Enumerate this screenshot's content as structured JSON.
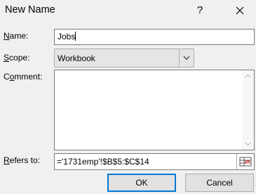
{
  "window": {
    "title": "New Name",
    "help_label": "?",
    "close_icon": "close-icon"
  },
  "fields": {
    "name_label_acc": "N",
    "name_label_rest": "ame:",
    "name_value": "Jobs",
    "scope_label_acc": "S",
    "scope_label_rest": "cope:",
    "scope_value": "Workbook",
    "comment_label_pre": "C",
    "comment_label_acc": "o",
    "comment_label_rest": "mment:",
    "comment_value": "",
    "refers_label_acc": "R",
    "refers_label_rest": "efers to:",
    "refers_value": "='1731emp'!$B$5:$C$14"
  },
  "buttons": {
    "ok_label": "OK",
    "cancel_label": "Cancel"
  },
  "colors": {
    "dialog_bg": "#f0f0f0",
    "default_button_border": "#0078d7"
  }
}
